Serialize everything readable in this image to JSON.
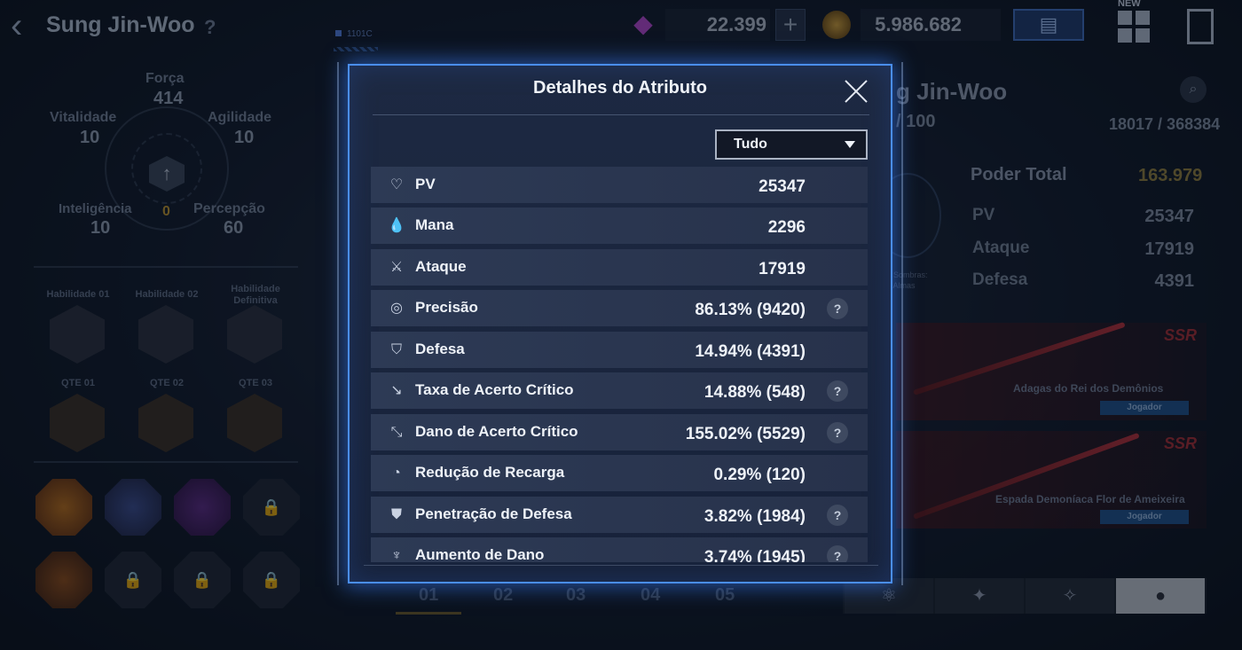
{
  "header": {
    "character_name": "Sung Jin-Woo",
    "help_label": "?",
    "code_tag": "1101C",
    "gems": "22.399",
    "plus_label": "+",
    "gold": "5.986.682",
    "new_badge": "NEW"
  },
  "stats": {
    "forca_label": "Força",
    "forca_value": "414",
    "vitalidade_label": "Vitalidade",
    "vitalidade_value": "10",
    "agilidade_label": "Agilidade",
    "agilidade_value": "10",
    "inteligencia_label": "Inteligência",
    "inteligencia_value": "10",
    "percepcao_label": "Percepção",
    "percepcao_value": "60",
    "available_points": "0"
  },
  "skills": {
    "hab1": "Habilidade 01",
    "hab2": "Habilidade 02",
    "hab_def": "Habilidade Definitiva",
    "qte1": "QTE 01",
    "qte2": "QTE 02",
    "qte3": "QTE 03"
  },
  "right_panel": {
    "name": "g Jin-Woo",
    "level": "/ 100",
    "exp": "18017 / 368384",
    "emblem_caption_1": "s Sombras:",
    "emblem_caption_2": "s Almas",
    "power_label": "Poder Total",
    "power_value": "163.979",
    "rows": [
      {
        "label": "PV",
        "value": "25347",
        "icon": "drop-icon"
      },
      {
        "label": "Ataque",
        "value": "17919",
        "icon": "sword-icon"
      },
      {
        "label": "Defesa",
        "value": "4391",
        "icon": "shield-icon"
      }
    ],
    "weapons": [
      {
        "rarity": "SSR",
        "name": "Adagas do Rei dos Demônios",
        "owner": "Jogador"
      },
      {
        "rarity": "SSR",
        "name": "Espada Demoníaca Flor de Ameixeira",
        "owner": "Jogador"
      }
    ]
  },
  "pages": [
    "01",
    "02",
    "03",
    "04",
    "05"
  ],
  "modal": {
    "title": "Detalhes do Atributo",
    "filter_selected": "Tudo",
    "help_label": "?",
    "attributes": [
      {
        "label": "PV",
        "value": "25347",
        "icon": "heart-icon",
        "help": false
      },
      {
        "label": "Mana",
        "value": "2296",
        "icon": "drop-icon",
        "help": false
      },
      {
        "label": "Ataque",
        "value": "17919",
        "icon": "sword-icon",
        "help": false
      },
      {
        "label": "Precisão",
        "value": "86.13% (9420)",
        "icon": "target-icon",
        "help": true
      },
      {
        "label": "Defesa",
        "value": "14.94% (4391)",
        "icon": "shield-icon",
        "help": false
      },
      {
        "label": "Taxa de Acerto Crítico",
        "value": "14.88% (548)",
        "icon": "crit-rate-icon",
        "help": true
      },
      {
        "label": "Dano de Acerto Crítico",
        "value": "155.02% (5529)",
        "icon": "crit-damage-icon",
        "help": true
      },
      {
        "label": "Redução de Recarga",
        "value": "0.29% (120)",
        "icon": "cooldown-icon",
        "help": false
      },
      {
        "label": "Penetração de Defesa",
        "value": "3.82% (1984)",
        "icon": "penetration-icon",
        "help": true
      },
      {
        "label": "Aumento de Dano",
        "value": "3.74% (1945)",
        "icon": "damage-up-icon",
        "help": true
      }
    ]
  }
}
